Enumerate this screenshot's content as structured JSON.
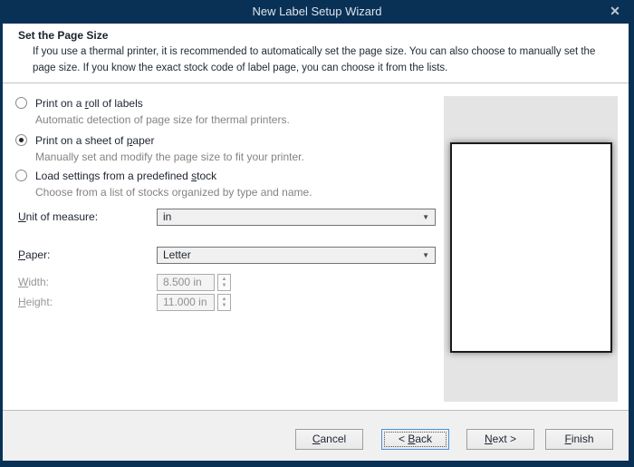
{
  "window": {
    "title": "New Label Setup Wizard",
    "close_icon": "✕"
  },
  "header": {
    "title": "Set the Page Size",
    "description_line1": "If you use a thermal printer, it is recommended to automatically set the page size. You can also choose to manually set the",
    "description_line2": "page size. If you know the exact stock code of label page, you can choose it from the lists."
  },
  "options": [
    {
      "pre": "Print on a ",
      "key": "r",
      "post": "oll of labels",
      "description": "Automatic detection of page size for thermal printers.",
      "selected": false
    },
    {
      "pre": "Print on a sheet of ",
      "key": "p",
      "post": "aper",
      "description": "Manually set and modify the page size to fit your printer.",
      "selected": true
    },
    {
      "pre": "Load settings from a predefined ",
      "key": "s",
      "post": "tock",
      "description": "Choose from a list of stocks organized by type and name.",
      "selected": false
    }
  ],
  "form": {
    "unit_label": {
      "key": "U",
      "post": "nit of measure:"
    },
    "unit_value": "in",
    "paper_label": {
      "key": "P",
      "post": "aper:"
    },
    "paper_value": "Letter",
    "width_label": {
      "key": "W",
      "post": "idth:"
    },
    "width_value": "8.500 in",
    "height_label": {
      "key": "H",
      "post": "eight:"
    },
    "height_value": "11.000 in",
    "dropdown_arrow": "▼",
    "spinner_up": "▲",
    "spinner_down": "▼"
  },
  "buttons": {
    "cancel": {
      "pre": "",
      "key": "C",
      "post": "ancel"
    },
    "back": {
      "pre": "< ",
      "key": "B",
      "post": "ack"
    },
    "next": {
      "pre": "",
      "key": "N",
      "post": "ext >"
    },
    "finish": {
      "pre": "",
      "key": "F",
      "post": "inish"
    }
  },
  "colors": {
    "frame_navy": "#093156",
    "title_text": "#dde3ea",
    "body_bg": "#ffffff",
    "footer_bg": "#f0f0f0",
    "preview_bg": "#e4e4e4",
    "focus_blue": "#4a90d9",
    "disabled_text": "#8f8f8f"
  }
}
